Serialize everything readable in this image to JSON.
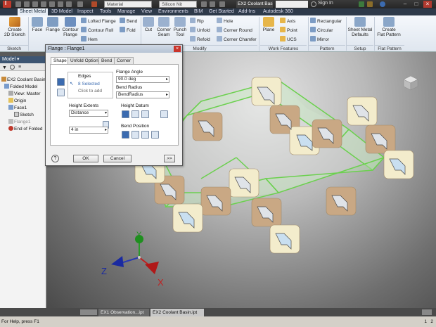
{
  "titlebar": {
    "material": "Material",
    "appearance": "Silicon Nit",
    "doc_title": "EX2 Coolant Basin...",
    "sign_in": "Sign In"
  },
  "tabs": [
    "Sheet Metal",
    "3D Model",
    "Inspect",
    "Tools",
    "Manage",
    "View",
    "Environments",
    "BIM",
    "Get Started",
    "Add-Ins",
    "Autodesk 360"
  ],
  "ribbon": {
    "sketch": {
      "create": "Create\n2D Sketch",
      "panel": "Sketch"
    },
    "create": {
      "face": "Face",
      "flange": "Flange",
      "contour_flange": "Contour\nFlange",
      "lofted_flange": "Lofted Flange",
      "contour_roll": "Contour Roll",
      "hem": "Hem",
      "bend": "Bend",
      "fold": "Fold"
    },
    "modify": {
      "cut": "Cut",
      "corner_seam": "Corner\nSeam",
      "punch_tool": "Punch\nTool",
      "rip": "Rip",
      "unfold": "Unfold",
      "refold": "Refold",
      "hole": "Hole",
      "corner_round": "Corner Round",
      "corner_chamfer": "Corner Chamfer",
      "panel": "Modify"
    },
    "work_features": {
      "plane": "Plane",
      "axis": "Axis",
      "point": "Point",
      "ucs": "UCS",
      "panel": "Work Features"
    },
    "pattern": {
      "rectangular": "Rectangular",
      "circular": "Circular",
      "mirror": "Mirror",
      "panel": "Pattern"
    },
    "setup": {
      "defaults": "Sheet Metal\nDefaults",
      "panel": "Setup"
    },
    "flat_pattern": {
      "create": "Create\nFlat Pattern",
      "panel": "Flat Pattern"
    }
  },
  "browser": {
    "title": "Model",
    "items": [
      "EX2 Coolant Basin...",
      "Folded Model",
      "View: Master",
      "Origin",
      "Face1",
      "Sketch",
      "Flange1",
      "End of Folded"
    ]
  },
  "dialog": {
    "title": "Flange : Flange1",
    "tabs": [
      "Shape",
      "Unfold Options",
      "Bend",
      "Corner"
    ],
    "edges_label": "Edges",
    "edges_selected": "8 Selected",
    "edges_hint": "Click to add",
    "flange_angle_label": "Flange Angle",
    "flange_angle": "90.0 deg",
    "bend_radius_label": "Bend Radius",
    "bend_radius": "BendRadius",
    "height_extents_label": "Height Extents",
    "height_extents": "Distance",
    "height_value": "4 in",
    "height_datum_label": "Height Datum",
    "bend_position_label": "Bend Position",
    "ok": "OK",
    "cancel": "Cancel",
    "more": ">>"
  },
  "axes": {
    "x": "X",
    "y": "Y",
    "z": "Z"
  },
  "doc_tabs": [
    "EX1 Observation...ipt",
    "EX2 Coolant Basin.ipt"
  ],
  "status": {
    "help": "For Help, press F1",
    "counts": [
      "1",
      "2"
    ]
  }
}
